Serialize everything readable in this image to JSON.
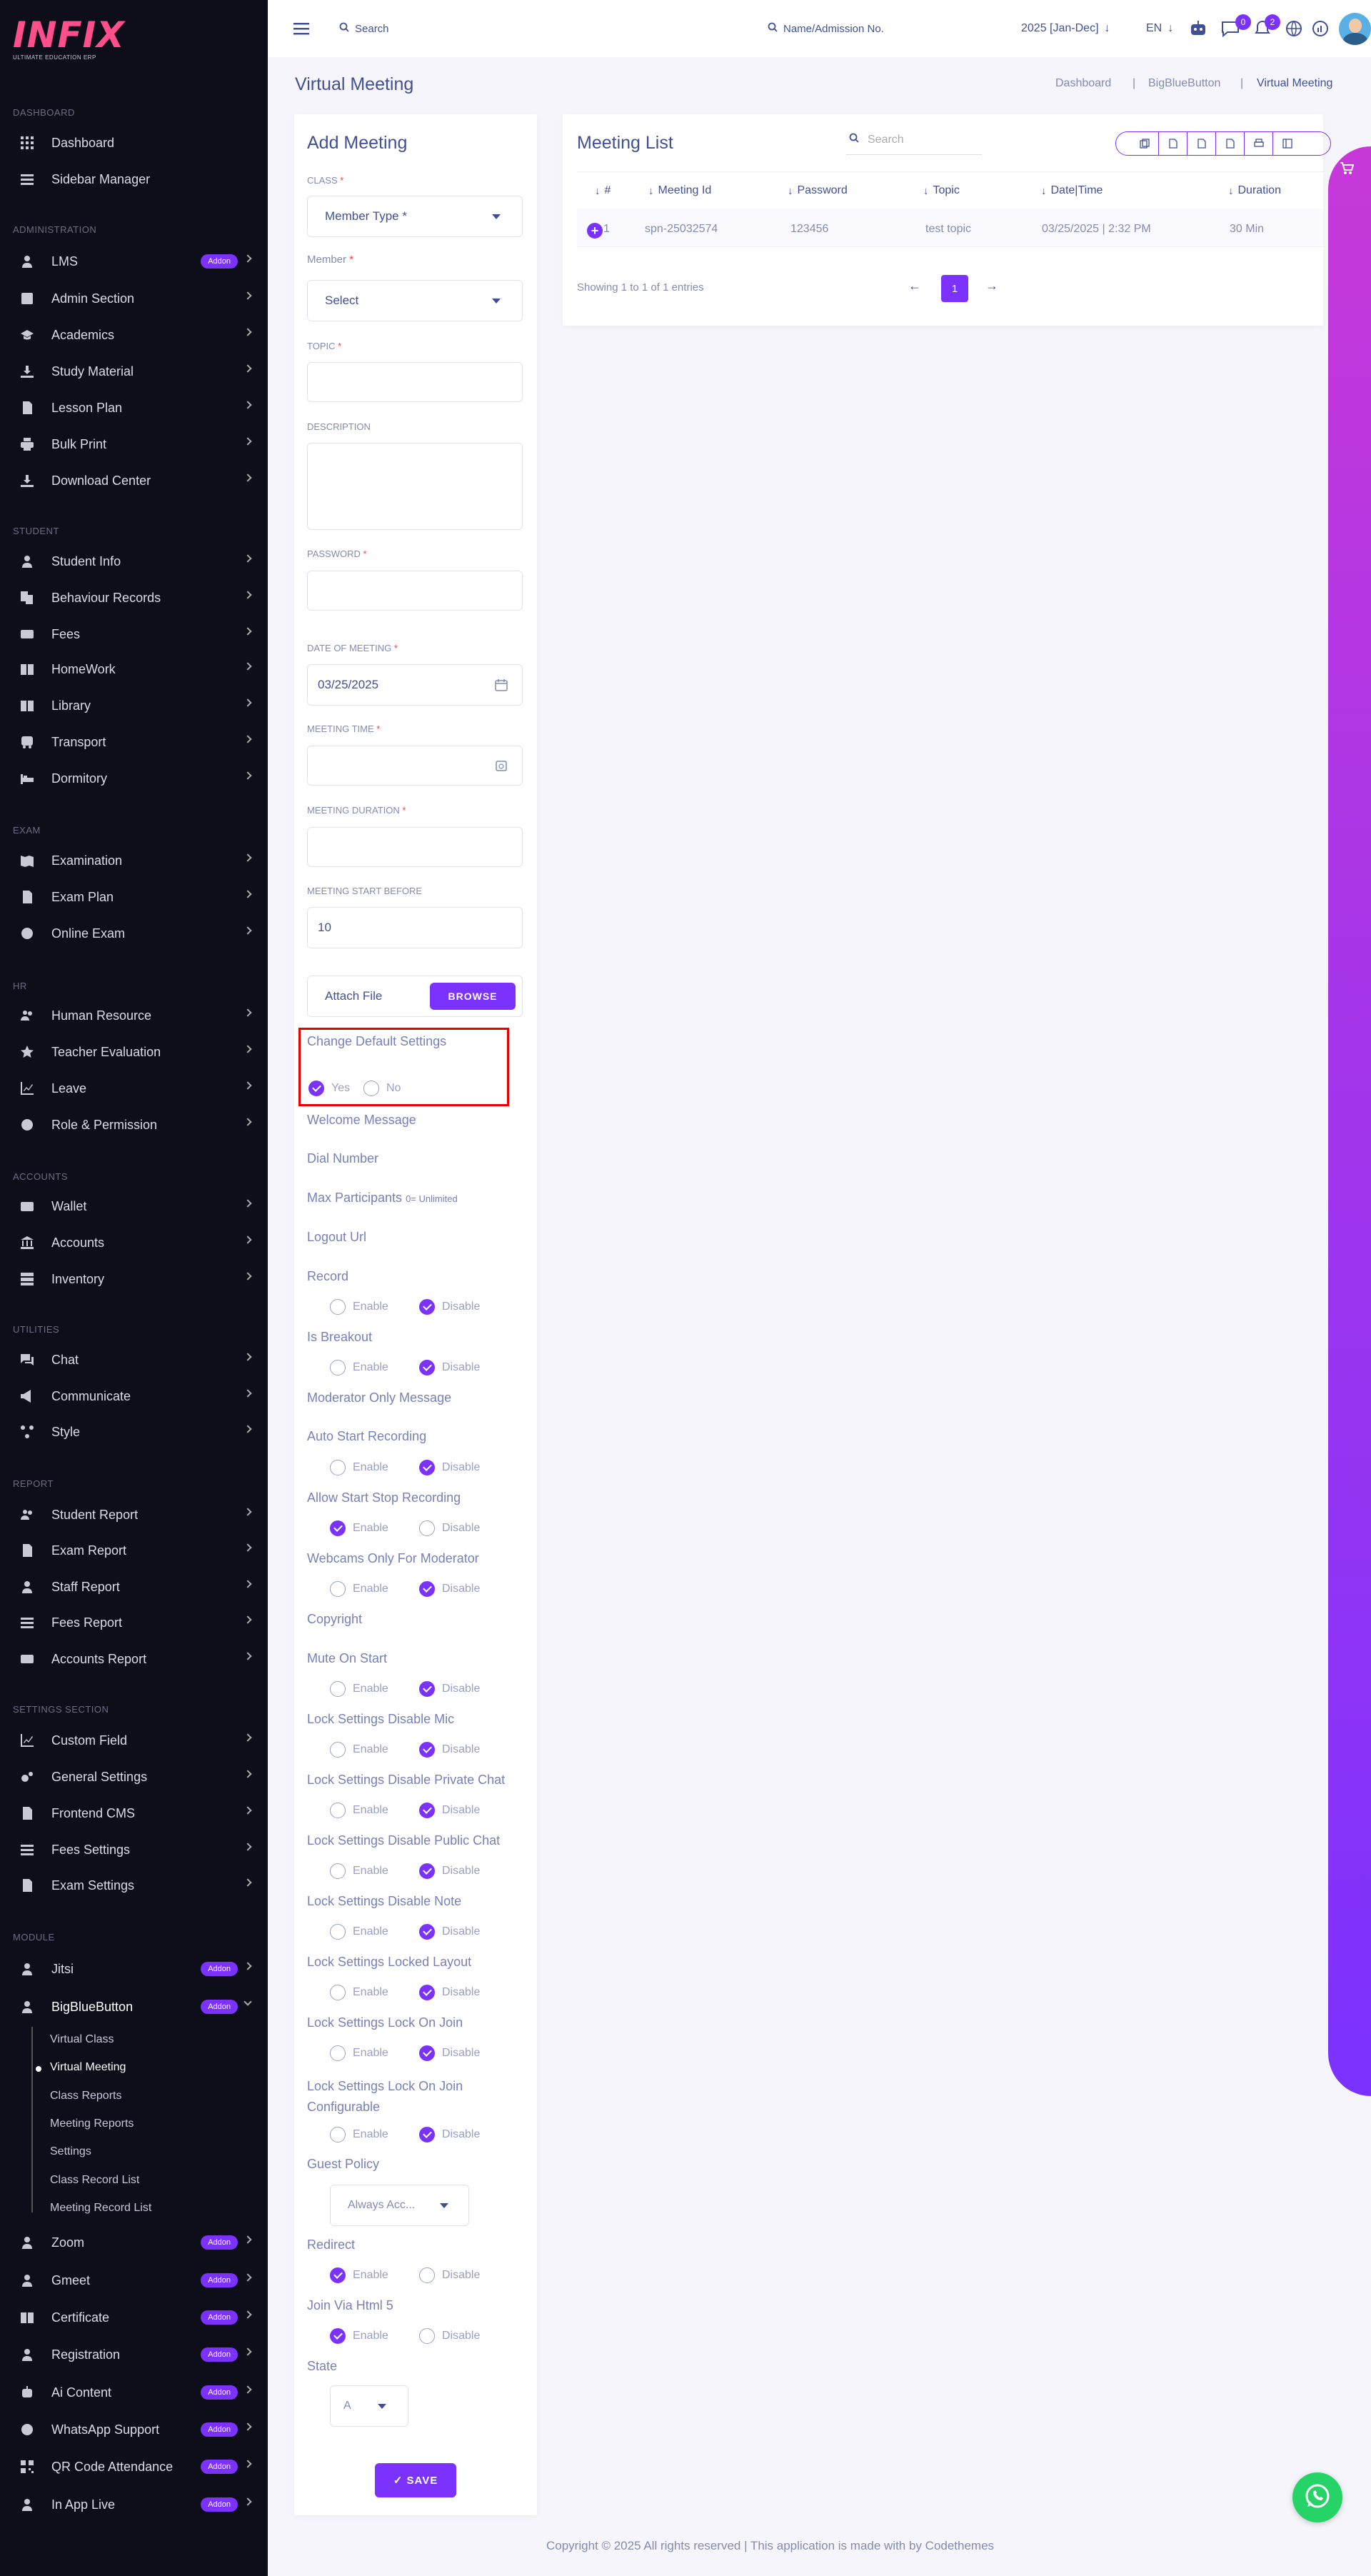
{
  "brand": {
    "logo": "INFIX",
    "tagline": "ULTIMATE EDUCATION ERP"
  },
  "topbar": {
    "search_placeholder": "Search",
    "student_search_placeholder": "Name/Admission No.",
    "session": "2025 [Jan-Dec]",
    "language": "EN",
    "messages_count": "0",
    "notifications_count": "2"
  },
  "sidebar": {
    "sections": [
      "DASHBOARD",
      "ADMINISTRATION",
      "STUDENT",
      "EXAM",
      "HR",
      "ACCOUNTS",
      "UTILITIES",
      "REPORT",
      "SETTINGS SECTION",
      "MODULE"
    ],
    "items": {
      "dashboard": "Dashboard",
      "sidebar_manager": "Sidebar Manager",
      "lms": "LMS",
      "admin_section": "Admin Section",
      "academics": "Academics",
      "study_material": "Study Material",
      "lesson_plan": "Lesson Plan",
      "bulk_print": "Bulk Print",
      "download_center": "Download Center",
      "student_info": "Student Info",
      "behaviour_records": "Behaviour Records",
      "fees": "Fees",
      "homework": "HomeWork",
      "library": "Library",
      "transport": "Transport",
      "dormitory": "Dormitory",
      "examination": "Examination",
      "exam_plan": "Exam Plan",
      "online_exam": "Online Exam",
      "human_resource": "Human Resource",
      "teacher_evaluation": "Teacher Evaluation",
      "leave": "Leave",
      "role_permission": "Role & Permission",
      "wallet": "Wallet",
      "accounts": "Accounts",
      "inventory": "Inventory",
      "chat": "Chat",
      "communicate": "Communicate",
      "style": "Style",
      "student_report": "Student Report",
      "exam_report": "Exam Report",
      "staff_report": "Staff Report",
      "fees_report": "Fees Report",
      "accounts_report": "Accounts Report",
      "custom_field": "Custom Field",
      "general_settings": "General Settings",
      "frontend_cms": "Frontend CMS",
      "fees_settings": "Fees Settings",
      "exam_settings": "Exam Settings",
      "jitsi": "Jitsi",
      "bigbluebutton": "BigBlueButton",
      "zoom": "Zoom",
      "gmeet": "Gmeet",
      "certificate": "Certificate",
      "registration": "Registration",
      "ai_content": "Ai Content",
      "whatsapp_support": "WhatsApp Support",
      "qr_code_attendance": "QR Code Attendance",
      "in_app_live": "In App Live"
    },
    "addon_label": "Addon",
    "submenu": [
      "Virtual Class",
      "Virtual Meeting",
      "Class Reports",
      "Meeting Reports",
      "Settings",
      "Class Record List",
      "Meeting Record List"
    ]
  },
  "page": {
    "title": "Virtual Meeting",
    "breadcrumb": [
      "Dashboard",
      "BigBlueButton",
      "Virtual Meeting"
    ]
  },
  "form": {
    "title": "Add Meeting",
    "class_label": "CLASS",
    "class_value": "Member Type *",
    "member_label": "Member",
    "member_value": "Select",
    "topic_label": "TOPIC",
    "description_label": "DESCRIPTION",
    "password_label": "PASSWORD",
    "date_label": "DATE OF MEETING",
    "date_value": "03/25/2025",
    "time_label": "MEETING TIME",
    "duration_label": "MEETING DURATION",
    "start_before_label": "MEETING START BEFORE",
    "start_before_value": "10",
    "attach_label": "Attach File",
    "browse_label": "BROWSE",
    "change_settings_label": "Change Default Settings",
    "yes": "Yes",
    "no": "No",
    "welcome_message": "Welcome Message",
    "dial_number": "Dial Number",
    "max_participants": "Max Participants",
    "max_hint": "0= Unlimited",
    "logout_url": "Logout Url",
    "enable": "Enable",
    "disable": "Disable",
    "record": "Record",
    "is_breakout": "Is Breakout",
    "moderator_only": "Moderator Only Message",
    "auto_start": "Auto Start Recording",
    "allow_start_stop": "Allow Start Stop Recording",
    "webcams_moderator": "Webcams Only For Moderator",
    "copyright": "Copyright",
    "mute_on_start": "Mute On Start",
    "lock_mic": "Lock Settings Disable Mic",
    "lock_private_chat": "Lock Settings Disable Private Chat",
    "lock_public_chat": "Lock Settings Disable Public Chat",
    "lock_note": "Lock Settings Disable Note",
    "lock_layout": "Lock Settings Locked Layout",
    "lock_on_join": "Lock Settings Lock On Join",
    "lock_on_join_config": "Lock Settings Lock On Join Configurable",
    "guest_policy": "Guest Policy",
    "guest_policy_value": "Always Acc...",
    "redirect": "Redirect",
    "join_html5": "Join Via Html 5",
    "state": "State",
    "state_value": "A",
    "save_label": "✓ SAVE"
  },
  "list": {
    "title": "Meeting List",
    "search_placeholder": "Search",
    "headers": [
      "#",
      "Meeting Id",
      "Password",
      "Topic",
      "Date|Time",
      "Duration"
    ],
    "row": {
      "num": "1",
      "meeting_id": "spn-25032574",
      "password": "123456",
      "topic": "test topic",
      "datetime": "03/25/2025 | 2:32 PM",
      "duration": "30 Min"
    },
    "info": "Showing 1 to 1 of 1 entries",
    "page": "1"
  },
  "footer": "Copyright © 2025 All rights reserved | This application is made with by Codethemes",
  "colors": {
    "accent": "#7c32ff",
    "sidebar": "#0e0e1b",
    "text": "#415094",
    "whatsapp": "#25d366",
    "highlight": "#e60000"
  }
}
